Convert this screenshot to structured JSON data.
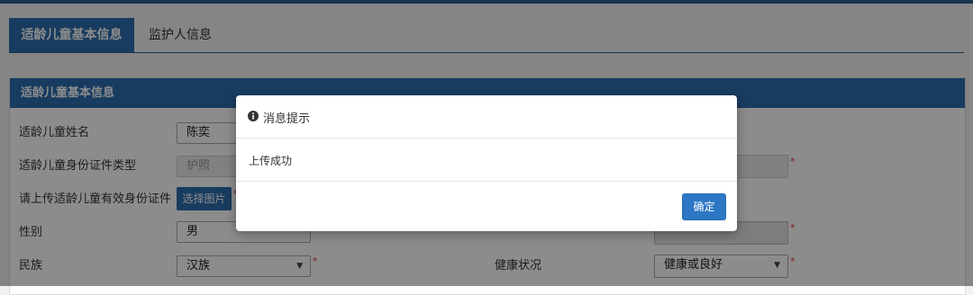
{
  "tabs": [
    "适龄儿童基本信息",
    "监护人信息"
  ],
  "panel": {
    "title": "适龄儿童基本信息",
    "labels": {
      "name": "适龄儿童姓名",
      "id_type": "适龄儿童身份证件类型",
      "upload": "请上传适龄儿童有效身份证件",
      "gender": "性别",
      "ethnicity": "民族",
      "health": "健康状况"
    },
    "values": {
      "name": "陈奕",
      "id_type": "护照",
      "gender": "男",
      "ethnicity": "汉族",
      "health": "健康或良好"
    },
    "upload_button": "选择图片",
    "required_mark": "*",
    "dropdown_arrow": "▼"
  },
  "dialog": {
    "title": "消息提示",
    "message": "上传成功",
    "ok_label": "确定",
    "icon": "info-circle-icon"
  }
}
